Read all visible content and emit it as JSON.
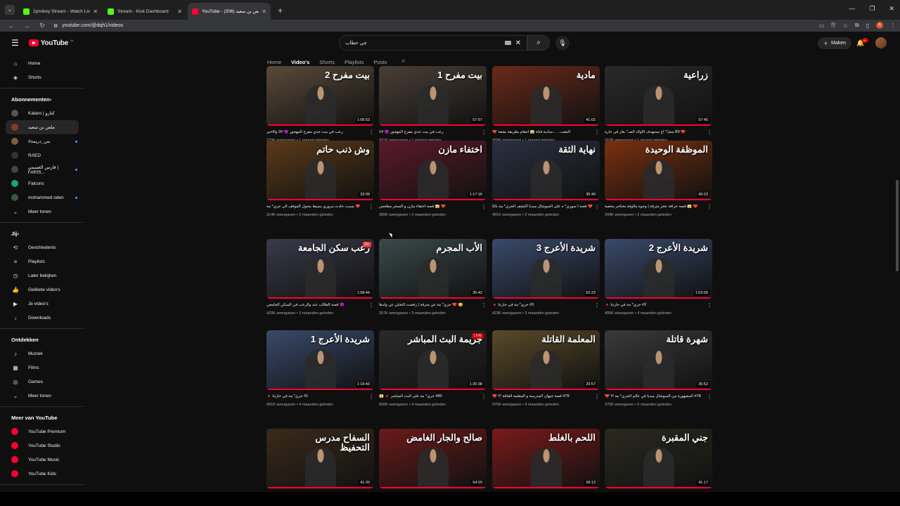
{
  "browser": {
    "tabs": [
      {
        "title": "2pmikey Stream - Watch Live o",
        "color": "#53fc18",
        "active": false
      },
      {
        "title": "Stream - Kick Dashboard",
        "color": "#53fc18",
        "active": false
      },
      {
        "title": "YouTube - ملص بن سعيد (206)",
        "color": "#ff0033",
        "active": true
      }
    ],
    "url": "youtube.com/@dqh1/videos"
  },
  "youtube": {
    "logo_text": "YouTube",
    "logo_region": "NL",
    "search_query": "جي حطاب",
    "create_label": "Maken",
    "notification_count": "9+"
  },
  "channel_tabs": [
    "Home",
    "Video's",
    "Shorts",
    "Playlists",
    "Posts"
  ],
  "sidebar": {
    "top": [
      {
        "label": "Home",
        "icon": "home-icon",
        "glyph": "⌂"
      },
      {
        "label": "Shorts",
        "icon": "shorts-icon",
        "glyph": "◈"
      }
    ],
    "subs_heading": "Abonnementen",
    "subs": [
      {
        "label": "Kataro | كتارو",
        "color": "#555",
        "live": false
      },
      {
        "label": "ملص بن سعيد",
        "color": "#8b3a2a",
        "live": false,
        "selected": true
      },
      {
        "label": "#بني_دريمة",
        "color": "#7a6040",
        "live": true
      },
      {
        "label": "RAED",
        "color": "#333",
        "live": false
      },
      {
        "label": "فارس العسمي | FARIS...",
        "color": "#444",
        "live": true
      },
      {
        "label": "Falcons",
        "color": "#1aa37a",
        "live": false
      },
      {
        "label": "mohammed oden",
        "color": "#3b5a3a",
        "live": true
      }
    ],
    "subs_more": "Meer tonen",
    "you_heading": "Jij",
    "you": [
      {
        "label": "Geschiedenis",
        "icon": "history-icon",
        "glyph": "⟲"
      },
      {
        "label": "Playlists",
        "icon": "playlists-icon",
        "glyph": "≡"
      },
      {
        "label": "Later bekijken",
        "icon": "watch-later-icon",
        "glyph": "◷"
      },
      {
        "label": "Gelikete video's",
        "icon": "like-icon",
        "glyph": "👍"
      },
      {
        "label": "Je video's",
        "icon": "your-videos-icon",
        "glyph": "▶"
      },
      {
        "label": "Downloads",
        "icon": "download-icon",
        "glyph": "↓"
      }
    ],
    "explore_heading": "Ontdekken",
    "explore": [
      {
        "label": "Muziek",
        "icon": "music-icon",
        "glyph": "♪"
      },
      {
        "label": "Films",
        "icon": "films-icon",
        "glyph": "▦"
      },
      {
        "label": "Games",
        "icon": "games-icon",
        "glyph": "◎"
      }
    ],
    "explore_more": "Meer tonen",
    "more_heading": "Meer van YouTube",
    "more": [
      {
        "label": "YouTube Premium"
      },
      {
        "label": "YouTube Studio"
      },
      {
        "label": "YouTube Music"
      },
      {
        "label": "YouTube Kids"
      }
    ]
  },
  "videos": [
    {
      "thumb_text": "بيت مفرح 2",
      "bg": "#5a4a3a",
      "duration": "1:06:53",
      "title": "رعب في بيت جدي مفرح المهجور 👿 #2 والأخير",
      "meta": "279K weergaven • 1 maand geleden"
    },
    {
      "thumb_text": "بيت مفرح 1",
      "bg": "#4a3f36",
      "duration": "57:07",
      "title": "رعب في بيت جدي مفرح المهجور 👿 #1",
      "meta": "371K weergaven • 1 maand geleden"
    },
    {
      "thumb_text": "مادية",
      "bg": "#6a2a1a",
      "duration": "41:02",
      "title": "المقب... ...سادية فتاة 😱 انتقام بطريقة بشعة ❤️",
      "meta": "258K weergaven • 1 maand geleden"
    },
    {
      "thumb_text": "زراعية",
      "bg": "#2a2a2a",
      "duration": "57:45",
      "title": "❤️ B9 سفّ* اح يستهدف الأولاد الصـ* ـغار في حارة",
      "meta": "310K weergaven • 1 maand geleden"
    },
    {
      "thumb_text": "وش ذنب حاتم",
      "bg": "#5a3a1a",
      "duration": "33:09",
      "title": "❤️ بسبب حادث مروري بسيط يتحول الموقف الى جري* مة",
      "meta": "314K weergaven • 2 maanden geleden"
    },
    {
      "thumb_text": "اختفاء مازن",
      "bg": "#5a1a2a",
      "duration": "1:17:18",
      "title": "❤️ 😱 قصة اختفاء مازن و السحر مطحس",
      "meta": "380K weergaven • 2 maanden geleden"
    },
    {
      "thumb_text": "نهاية الثقة",
      "bg": "#2a3040",
      "duration": "35:49",
      "title": "❤️ قصة ا سوري* ه على السوشال ميديا اكتشف الجري* مة بالكامل 😱",
      "meta": "401K weergaven • 2 maanden geleden"
    },
    {
      "thumb_text": "الموظفة الوحيدة",
      "bg": "#7a3010",
      "duration": "43:23",
      "title": "❤️ 😱 قصة خرافة عجز مترفة | وجوه مألوفة يختاجر مخفية",
      "meta": "344K weergaven • 2 maanden geleden"
    },
    {
      "thumb_text": "رعب سكن الجامعة",
      "bg": "#3a3a4a",
      "duration": "1:08:44",
      "title": "👿 قصة الطالب عند والرعب في السكن الجامعي",
      "meta": "420K weergaven • 3 maanden geleden",
      "tag": "18+"
    },
    {
      "thumb_text": "الأب المجرم",
      "bg": "#3a4a4a",
      "duration": "35:42",
      "title": "🤫 ❤️ جري* مة عن مترفة | رفضت التخلي عن ولدها",
      "meta": "357K weergaven • 3 maanden geleden"
    },
    {
      "thumb_text": "شريدة الأعرج 3",
      "bg": "#3a4a6a",
      "duration": "52:23",
      "title": "#3 جري* مة في حارتنا 🔺",
      "meta": "423K weergaven • 3 maanden geleden"
    },
    {
      "thumb_text": "شريدة الأعرج 2",
      "bg": "#3a4a6a",
      "duration": "1:03:09",
      "title": "#2 جري* مة في حارتنا 🔺",
      "meta": "495K weergaven • 4 maanden geleden"
    },
    {
      "thumb_text": "شريدة الأعرج 1",
      "bg": "#3a4a6a",
      "duration": "1:19:43",
      "title": "#1 جري* مة في حارتنا 🔺",
      "meta": "681K weergaven • 4 maanden geleden"
    },
    {
      "thumb_text": "جريمة البث المباشر",
      "bg": "#2a2a2a",
      "duration": "1:20:38",
      "title": "#80 جري* مة على البث المباشر 🔺 😱",
      "meta": "650K weergaven • 4 maanden geleden",
      "live": "LIVE"
    },
    {
      "thumb_text": "المعلمة القاتلة",
      "bg": "#5a4a2a",
      "duration": "29:57",
      "title": "#79 قصة جيهان المدرسة و المعلمة القاتلة !!! ❤️",
      "meta": "476K weergaven • 4 maanden geleden"
    },
    {
      "thumb_text": "شهرة قاتلة",
      "bg": "#3a3a3a",
      "duration": "35:52",
      "title": "#78 المشهورة من السوشال ميديا في عالم الجري* مة !!! ❤️",
      "meta": "370K weergaven • 5 maanden geleden"
    },
    {
      "thumb_text": "السفاح مدرس التحفيظ",
      "bg": "#3a2a1a",
      "duration": "41:20",
      "title": "",
      "meta": ""
    },
    {
      "thumb_text": "صالح والجار الغامض",
      "bg": "#6a1a1a",
      "duration": "54:29",
      "title": "",
      "meta": ""
    },
    {
      "thumb_text": "اللحم بالغلط",
      "bg": "#7a1a1a",
      "duration": "28:13",
      "title": "",
      "meta": ""
    },
    {
      "thumb_text": "جني المقبرة",
      "bg": "#2a2a20",
      "duration": "41:17",
      "title": "",
      "meta": ""
    }
  ]
}
